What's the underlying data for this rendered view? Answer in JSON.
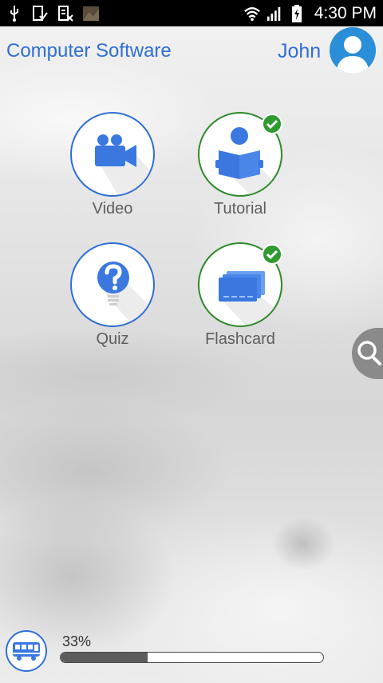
{
  "status_bar": {
    "time": "4:30 PM",
    "icons": [
      "usb-icon",
      "download-check-icon",
      "sim-blocked-icon",
      "photo-thumbnail-icon",
      "wifi-icon",
      "signal-icon",
      "battery-charging-icon"
    ]
  },
  "header": {
    "title": "Computer Software",
    "user_name": "John",
    "avatar_icon": "person-icon"
  },
  "tiles": [
    {
      "label": "Video",
      "icon": "video-camera-icon",
      "completed": false
    },
    {
      "label": "Tutorial",
      "icon": "reading-person-icon",
      "completed": true
    },
    {
      "label": "Quiz",
      "icon": "question-bulb-icon",
      "completed": false
    },
    {
      "label": "Flashcard",
      "icon": "flashcards-icon",
      "completed": true
    }
  ],
  "side_tab": {
    "icon": "search-icon"
  },
  "footer": {
    "progress_text": "33%",
    "progress_value": 0.33,
    "bus_icon": "bus-icon"
  },
  "colors": {
    "accent_blue": "#2f6fd6",
    "icon_blue": "#3a78e0",
    "complete_green": "#2f8a2c",
    "label_gray": "#5e5e5e"
  }
}
